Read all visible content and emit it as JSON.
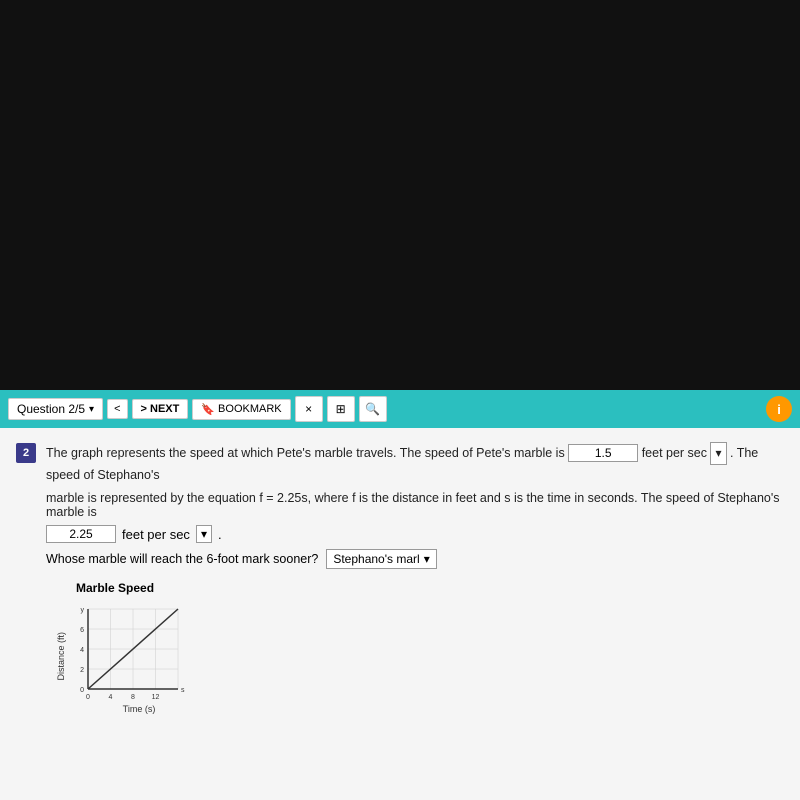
{
  "toolbar": {
    "question_label": "Question 2/5",
    "back_label": "<",
    "next_label": "> NEXT",
    "bookmark_label": "BOOKMARK",
    "close_label": "×",
    "grid_icon": "⊞",
    "search_icon": "🔍"
  },
  "question": {
    "number": "2",
    "text_before_input": "The graph represents the speed at which Pete's marble travels. The speed of Pete's marble is",
    "pete_speed_value": "1.5",
    "unit_label": "feet per sec",
    "text_after_unit": ". The speed of Stephano's",
    "equation_text": "marble is represented by the equation f = 2.25s, where f  is the distance in feet and s is the time in seconds.  The speed of Stephano's marble is",
    "stephano_speed_value": "2.25",
    "stephano_unit": "feet per sec",
    "whose_text": "Whose marble will reach the 6-foot mark sooner?",
    "whose_answer": "Stephano's marl",
    "graph_title": "Marble Speed",
    "y_axis_label": "Distance (ft)",
    "x_axis_label": "Time (s)",
    "y_ticks": [
      "y",
      "4",
      "2",
      "0"
    ],
    "x_ticks": [
      "0",
      "4",
      "8",
      "12"
    ]
  }
}
